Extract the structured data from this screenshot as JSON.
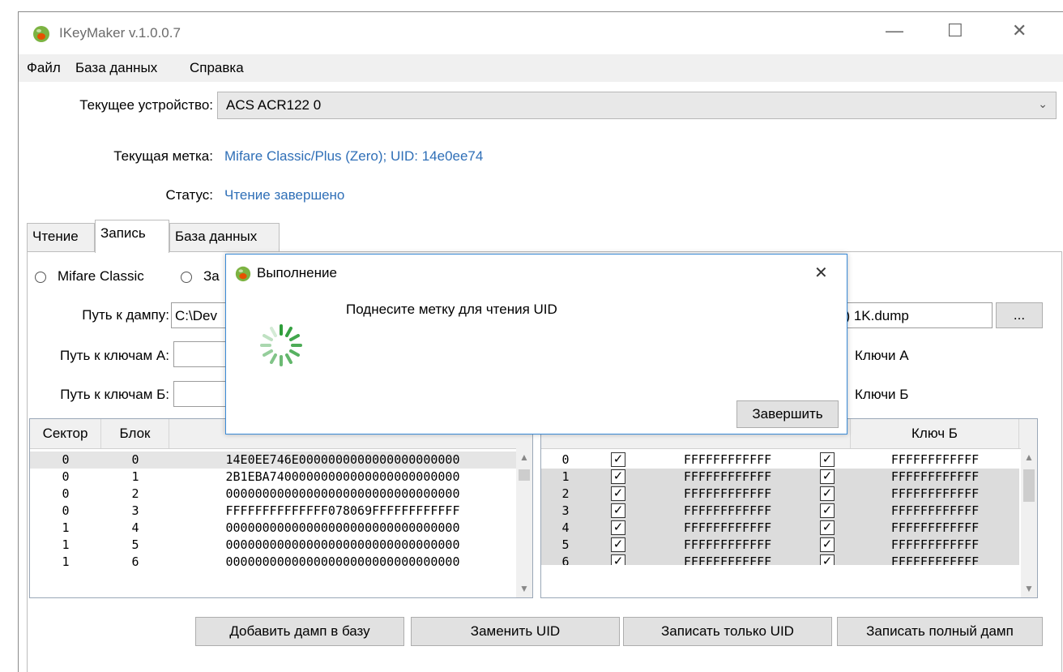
{
  "window": {
    "title": "IKeyMaker v.1.0.0.7",
    "controls": {
      "minimize": "—",
      "maximize": "☐",
      "close": "✕"
    }
  },
  "menu": [
    "Файл",
    "База данных",
    "Справка"
  ],
  "device": {
    "label": "Текущее устройство:",
    "value": "ACS ACR122 0"
  },
  "tag": {
    "label": "Текущая метка:",
    "value": "Mifare Classic/Plus (Zero); UID: 14e0ee74"
  },
  "status": {
    "label": "Статус:",
    "value": "Чтение завершено"
  },
  "tabs": [
    "Чтение",
    "Запись",
    "База данных"
  ],
  "write_tab": {
    "radio_1": "Mifare Classic",
    "radio_2": "За",
    "dump_path_label": "Путь к дампу:",
    "dump_path_value_left": "C:\\Dev",
    "dump_path_value_right": "5) 1K.dump",
    "browse_label": "...",
    "keys_a_label": "Путь к ключам А:",
    "keys_b_label": "Путь к ключам Б:",
    "keys_a_check": "Ключи А",
    "keys_b_check": "Ключи Б"
  },
  "blocks_table": {
    "headers": [
      "Сектор",
      "Блок"
    ],
    "rows": [
      [
        "0",
        "0",
        "14E0EE746E0000000000000000000000"
      ],
      [
        "0",
        "1",
        "2B1EBA74000000000000000000000000"
      ],
      [
        "0",
        "2",
        "00000000000000000000000000000000"
      ],
      [
        "0",
        "3",
        "FFFFFFFFFFFFFF078069FFFFFFFFFFFF"
      ],
      [
        "1",
        "4",
        "00000000000000000000000000000000"
      ],
      [
        "1",
        "5",
        "00000000000000000000000000000000"
      ],
      [
        "1",
        "6",
        "00000000000000000000000000000000"
      ]
    ]
  },
  "keys_table": {
    "header_key_b": "Ключ Б",
    "rows": [
      [
        "0",
        "FFFFFFFFFFFF",
        "FFFFFFFFFFFF"
      ],
      [
        "1",
        "FFFFFFFFFFFF",
        "FFFFFFFFFFFF"
      ],
      [
        "2",
        "FFFFFFFFFFFF",
        "FFFFFFFFFFFF"
      ],
      [
        "3",
        "FFFFFFFFFFFF",
        "FFFFFFFFFFFF"
      ],
      [
        "4",
        "FFFFFFFFFFFF",
        "FFFFFFFFFFFF"
      ],
      [
        "5",
        "FFFFFFFFFFFF",
        "FFFFFFFFFFFF"
      ],
      [
        "6",
        "FFFFFFFFFFFF",
        "FFFFFFFFFFFF"
      ]
    ],
    "check_mark": "✓"
  },
  "buttons": {
    "add_dump": "Добавить дамп в базу",
    "replace_uid": "Заменить UID",
    "write_uid": "Записать только UID",
    "write_full": "Записать полный дамп"
  },
  "dialog": {
    "title": "Выполнение",
    "close": "✕",
    "message": "Поднесите метку для чтения UID",
    "finish_button": "Завершить"
  },
  "colors": {
    "link": "#2f6fb7",
    "accent": "#3a8ad6",
    "spinner": "#2e9e3a"
  }
}
